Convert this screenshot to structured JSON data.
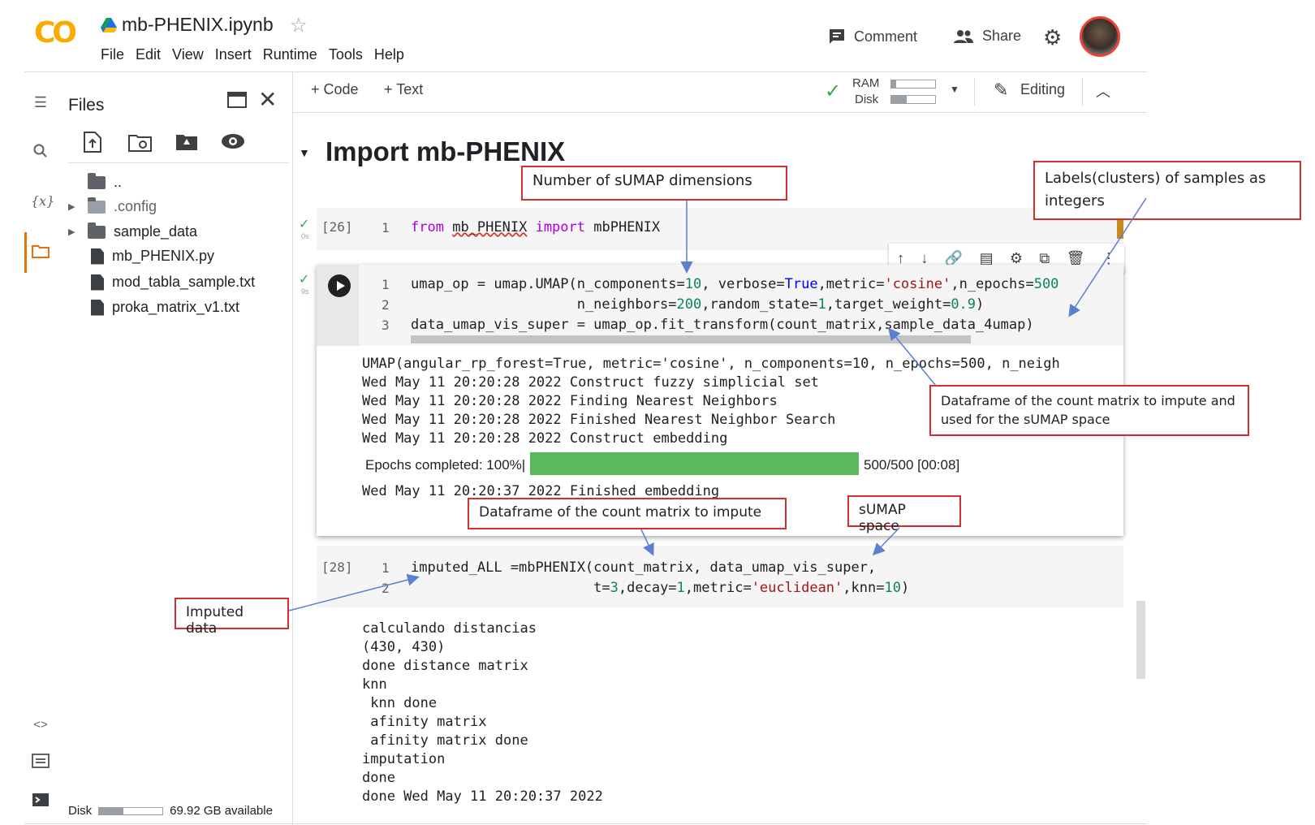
{
  "header": {
    "logo_text": "CO",
    "notebook_title": "mb-PHENIX.ipynb",
    "menu": [
      "File",
      "Edit",
      "View",
      "Insert",
      "Runtime",
      "Tools",
      "Help"
    ],
    "comment_label": "Comment",
    "share_label": "Share"
  },
  "toolbar": {
    "add_code": "+ Code",
    "add_text": "+ Text",
    "ram_label": "RAM",
    "disk_label": "Disk",
    "editing_label": "Editing"
  },
  "sidebar": {
    "title": "Files",
    "tree": [
      {
        "name": "..",
        "type": "parent"
      },
      {
        "name": ".config",
        "type": "folder"
      },
      {
        "name": "sample_data",
        "type": "folder"
      },
      {
        "name": "mb_PHENIX.py",
        "type": "file"
      },
      {
        "name": "mod_tabla_sample.txt",
        "type": "file"
      },
      {
        "name": "proka_matrix_v1.txt",
        "type": "file"
      }
    ],
    "disk_label": "Disk",
    "disk_available": "69.92 GB available"
  },
  "notebook": {
    "section_title": "Import mb-PHENIX",
    "cell1": {
      "exec": "[26]",
      "time": "0s",
      "line1_num": "1"
    },
    "cell2": {
      "time": "9s",
      "nums": [
        "1",
        "2",
        "3"
      ]
    },
    "cell3": {
      "exec": "[28]",
      "nums": [
        "1",
        "2"
      ]
    },
    "output2_lines": [
      "UMAP(angular_rp_forest=True, metric='cosine', n_components=10, n_epochs=500, n_neigh",
      "Wed May 11 20:20:28 2022 Construct fuzzy simplicial set",
      "Wed May 11 20:20:28 2022 Finding Nearest Neighbors",
      "Wed May 11 20:20:28 2022 Finished Nearest Neighbor Search",
      "Wed May 11 20:20:28 2022 Construct embedding"
    ],
    "progress": {
      "label": "Epochs completed: 100%|",
      "fraction": 1.0,
      "stats": "500/500 [00:08]",
      "color": "#5cb85c"
    },
    "output2_last": "Wed May 11 20:20:37 2022 Finished embedding",
    "output3_lines": [
      "calculando distancias",
      "(430, 430)",
      "done distance matrix",
      "knn",
      " knn done",
      " afinity matrix",
      " afinity matrix done",
      "imputation",
      "done",
      "done Wed May 11 20:20:37 2022"
    ]
  },
  "annotations": {
    "n_dims": "Number of sUMAP dimensions",
    "labels": "Labels(clusters) of samples as integers",
    "count_matrix_full": "Dataframe of the count matrix to impute and used for the sUMAP space",
    "count_matrix": "Dataframe of the count matrix to impute",
    "sumap_space": "sUMAP space",
    "imputed": "Imputed data"
  },
  "colors": {
    "annotation_border": "#d32f2f",
    "arrow": "#5b7fd1",
    "progress_green": "#5cb85c"
  }
}
